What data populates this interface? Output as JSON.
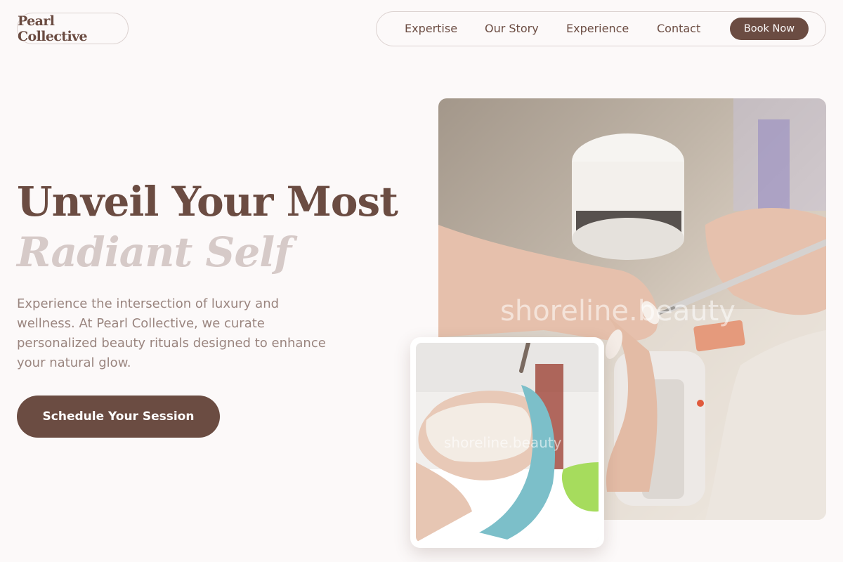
{
  "brand": {
    "name": "Pearl Collective"
  },
  "nav": {
    "links": [
      "Expertise",
      "Our Story",
      "Experience",
      "Contact"
    ],
    "book_label": "Book Now"
  },
  "hero": {
    "heading_line1": "Unveil Your Most",
    "heading_line2": "Radiant Self",
    "lede": "Experience the intersection of luxury and wellness. At Pearl Collective, we curate personalized beauty rituals designed to enhance your natural glow.",
    "cta_label": "Schedule Your Session"
  },
  "images": {
    "main_watermark": "shoreline.beauty",
    "inset_watermark": "shoreline.beauty",
    "main_icon": "manicure-photo",
    "inset_icon": "facial-treatment-photo"
  },
  "colors": {
    "accent": "#6b4c42",
    "accent_light": "#d6cac8",
    "text_muted": "#9a857f",
    "background": "#fcf9f9"
  }
}
